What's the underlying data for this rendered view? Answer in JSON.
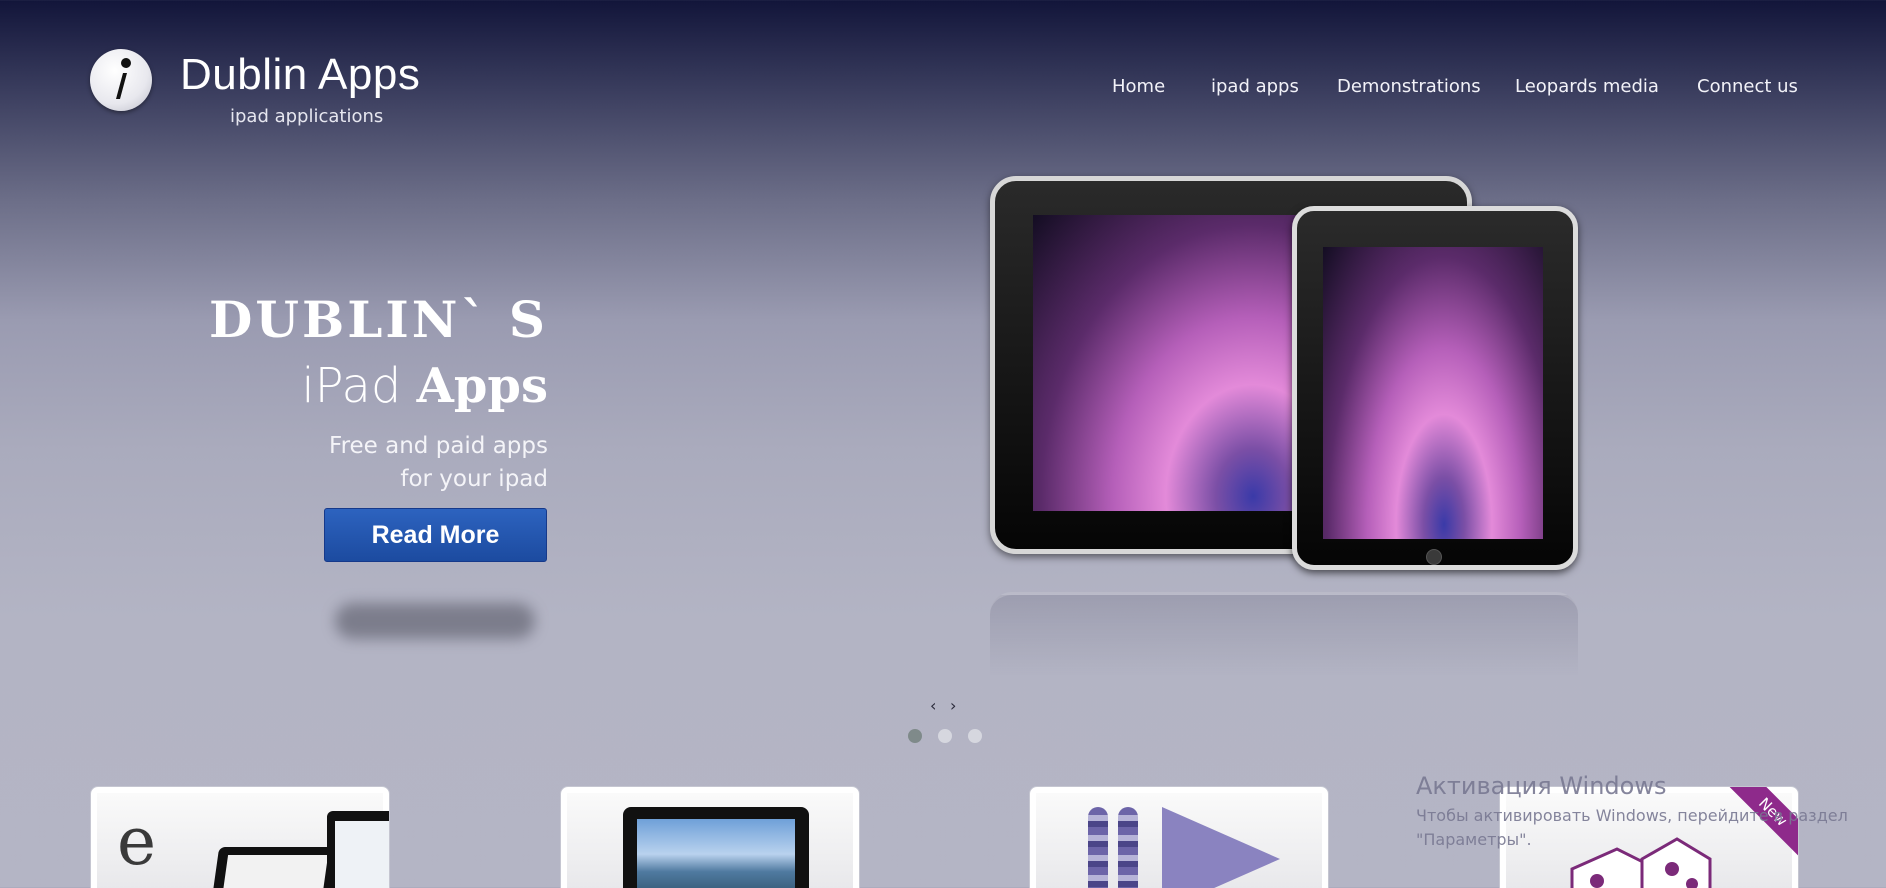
{
  "brand": {
    "title": "Dublin Apps",
    "subtitle": "ipad applications",
    "logo_icon": "info-i-icon"
  },
  "nav": {
    "items": [
      {
        "label": "Home"
      },
      {
        "label": "ipad apps"
      },
      {
        "label": "Demonstrations"
      },
      {
        "label": "Leopards media"
      },
      {
        "label": "Connect us"
      }
    ]
  },
  "hero": {
    "title_line1": "DUBLIN` S",
    "title_line2_thin": "iPad ",
    "title_line2_bold": "Apps",
    "sub_line1": "Free and paid apps",
    "sub_line2": "for your ipad",
    "button_label": "Read More",
    "button_color": "#1f4fa6"
  },
  "slider": {
    "prev": "‹",
    "next": "›",
    "dots": 3,
    "active_dot": 1
  },
  "cards": [
    {
      "icon": "ebook-tablet-icon"
    },
    {
      "icon": "photo-tablet-icon"
    },
    {
      "icon": "video-player-icon"
    },
    {
      "icon": "dice-icon",
      "ribbon": "New"
    }
  ],
  "watermark": {
    "title": "Активация Windows",
    "line1": "Чтобы активировать Windows, перейдите в раздел",
    "line2": "\"Параметры\"."
  }
}
